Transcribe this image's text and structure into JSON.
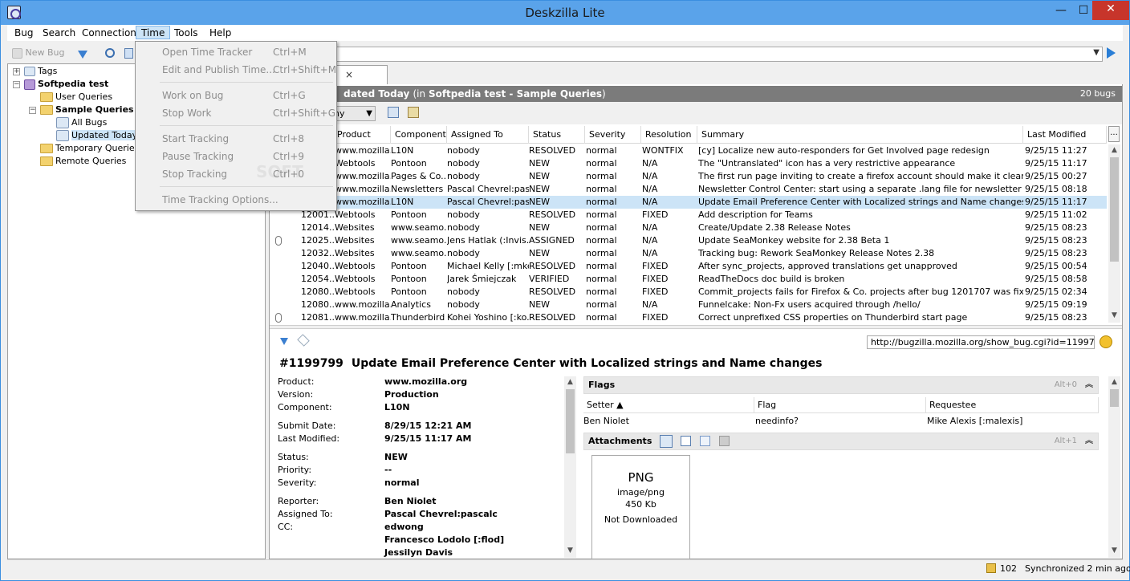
{
  "window": {
    "title": "Deskzilla Lite",
    "minimize": "—",
    "maximize": "☐",
    "close": "✕"
  },
  "menubar": [
    "Bug",
    "Search",
    "Connection",
    "Time",
    "Tools",
    "Help"
  ],
  "toolbar": {
    "new_bug": "New Bug"
  },
  "time_menu": [
    {
      "label": "Open Time Tracker",
      "shortcut": "Ctrl+M"
    },
    {
      "label": "Edit and Publish Time...",
      "shortcut": "Ctrl+Shift+M"
    },
    {
      "label": "Work on Bug",
      "shortcut": "Ctrl+G"
    },
    {
      "label": "Stop Work",
      "shortcut": "Ctrl+Shift+G"
    },
    {
      "label": "Start Tracking",
      "shortcut": "Ctrl+8"
    },
    {
      "label": "Pause Tracking",
      "shortcut": "Ctrl+9"
    },
    {
      "label": "Stop Tracking",
      "shortcut": "Ctrl+0"
    },
    {
      "label": "Time Tracking Options...",
      "shortcut": ""
    }
  ],
  "tree": {
    "tags": "Tags",
    "connection": "Softpedia test",
    "user_queries": "User Queries",
    "sample_queries": "Sample Queries",
    "all_bugs": "All Bugs",
    "updated_today": "Updated Today",
    "temporary_queries": "Temporary Queries",
    "remote_queries": "Remote Queries"
  },
  "query_header": {
    "title_part1": "dated Today",
    "title_part2": "(in ",
    "title_part3": "Softpedia test - Sample Queries",
    "title_part4": ")",
    "count": "20 bugs"
  },
  "hierarchy_combo": "chy",
  "columns": [
    "Product",
    "Component",
    "Assigned To",
    "Status",
    "Severity",
    "Resolution",
    "Summary",
    "Last Modified"
  ],
  "more_columns": "...",
  "bugs": [
    {
      "id": "",
      "product": "www.mozilla...",
      "component": "L10N",
      "assigned": "nobody",
      "status": "RESOLVED",
      "severity": "normal",
      "resolution": "WONTFIX",
      "summary": "[cy] Localize new auto-responders for Get Involved page redesign",
      "modified": "9/25/15 11:27",
      "attach": false
    },
    {
      "id": "",
      "product": "Webtools",
      "component": "Pontoon",
      "assigned": "nobody",
      "status": "NEW",
      "severity": "normal",
      "resolution": "N/A",
      "summary": "The \"Untranslated\" icon has a very restrictive appearance",
      "modified": "9/25/15 11:17",
      "attach": false
    },
    {
      "id": "",
      "product": "www.mozilla...",
      "component": "Pages & Co...",
      "assigned": "nobody",
      "status": "NEW",
      "severity": "normal",
      "resolution": "N/A",
      "summary": "The first run page inviting to create a firefox account should make it clearer that it...",
      "modified": "9/25/15 00:27",
      "attach": false
    },
    {
      "id": "",
      "product": "www.mozilla...",
      "component": "Newsletters",
      "assigned": "Pascal Chevrel:pas...",
      "status": "NEW",
      "severity": "normal",
      "resolution": "N/A",
      "summary": "Newsletter Control Center: start using a separate .lang file for newsletter locales",
      "modified": "9/25/15 08:18",
      "attach": false
    },
    {
      "id": "",
      "product": "www.mozilla...",
      "component": "L10N",
      "assigned": "Pascal Chevrel:pas...",
      "status": "NEW",
      "severity": "normal",
      "resolution": "N/A",
      "summary": "Update Email Preference Center with Localized strings and Name changes",
      "modified": "9/25/15 11:17",
      "attach": false,
      "selected": true
    },
    {
      "id": "12001...",
      "product": "Webtools",
      "component": "Pontoon",
      "assigned": "nobody",
      "status": "RESOLVED",
      "severity": "normal",
      "resolution": "FIXED",
      "summary": "Add description for Teams",
      "modified": "9/25/15 11:02",
      "attach": false
    },
    {
      "id": "12014...",
      "product": "Websites",
      "component": "www.seamo...",
      "assigned": "nobody",
      "status": "NEW",
      "severity": "normal",
      "resolution": "N/A",
      "summary": "Create/Update 2.38 Release Notes",
      "modified": "9/25/15 08:23",
      "attach": false
    },
    {
      "id": "12025...",
      "product": "Websites",
      "component": "www.seamo...",
      "assigned": "Jens Hatlak (:Invis...",
      "status": "ASSIGNED",
      "severity": "normal",
      "resolution": "N/A",
      "summary": "Update SeaMonkey website for 2.38 Beta 1",
      "modified": "9/25/15 08:23",
      "attach": true
    },
    {
      "id": "12032...",
      "product": "Websites",
      "component": "www.seamo...",
      "assigned": "nobody",
      "status": "NEW",
      "severity": "normal",
      "resolution": "N/A",
      "summary": "Tracking bug: Rework SeaMonkey Release Notes 2.38",
      "modified": "9/25/15 08:23",
      "attach": false
    },
    {
      "id": "12040...",
      "product": "Webtools",
      "component": "Pontoon",
      "assigned": "Michael Kelly [:mke...",
      "status": "RESOLVED",
      "severity": "normal",
      "resolution": "FIXED",
      "summary": "After sync_projects, approved translations get unapproved",
      "modified": "9/25/15 00:54",
      "attach": false
    },
    {
      "id": "12054...",
      "product": "Webtools",
      "component": "Pontoon",
      "assigned": "Jarek Śmiejczak",
      "status": "VERIFIED",
      "severity": "normal",
      "resolution": "FIXED",
      "summary": "ReadTheDocs doc build is broken",
      "modified": "9/25/15 08:58",
      "attach": false
    },
    {
      "id": "12080...",
      "product": "Webtools",
      "component": "Pontoon",
      "assigned": "nobody",
      "status": "RESOLVED",
      "severity": "normal",
      "resolution": "FIXED",
      "summary": "Commit_projects fails for Firefox & Co. projects after bug 1201707 was fixed",
      "modified": "9/25/15 02:34",
      "attach": false
    },
    {
      "id": "12080...",
      "product": "www.mozilla...",
      "component": "Analytics",
      "assigned": "nobody",
      "status": "NEW",
      "severity": "normal",
      "resolution": "N/A",
      "summary": "Funnelcake: Non-Fx users acquired through /hello/",
      "modified": "9/25/15 09:19",
      "attach": false
    },
    {
      "id": "12081...",
      "product": "www.mozilla...",
      "component": "Thunderbird",
      "assigned": "Kohei Yoshino [:ko...",
      "status": "RESOLVED",
      "severity": "normal",
      "resolution": "FIXED",
      "summary": "Correct unprefixed CSS properties on Thunderbird start page",
      "modified": "9/25/15 08:23",
      "attach": true
    }
  ],
  "detail": {
    "url": "http://bugzilla.mozilla.org/show_bug.cgi?id=1199799",
    "bug_number": "#1199799",
    "bug_title": "Update Email Preference Center with Localized strings and Name changes",
    "fields": [
      {
        "label": "Product:",
        "value": "www.mozilla.org"
      },
      {
        "label": "Version:",
        "value": "Production"
      },
      {
        "label": "Component:",
        "value": "L10N"
      },
      {
        "label": "Submit Date:",
        "value": "8/29/15 12:21 AM"
      },
      {
        "label": "Last Modified:",
        "value": "9/25/15 11:17 AM"
      },
      {
        "label": "Status:",
        "value": "NEW"
      },
      {
        "label": "Priority:",
        "value": "--"
      },
      {
        "label": "Severity:",
        "value": "normal"
      },
      {
        "label": "Reporter:",
        "value": "Ben Niolet"
      },
      {
        "label": "Assigned To:",
        "value": "Pascal Chevrel:pascalc"
      },
      {
        "label": "CC:",
        "value": "edwong"
      }
    ],
    "cc_more": [
      "Francesco Lodolo [:flod]",
      "Jessilyn Davis"
    ],
    "flags": {
      "title": "Flags",
      "shortcut": "Alt+0",
      "headers": [
        "Setter ▲",
        "Flag",
        "Requestee"
      ],
      "row": [
        "Ben Niolet",
        "needinfo?",
        "Mike Alexis [:malexis]"
      ]
    },
    "attachments": {
      "title": "Attachments",
      "shortcut": "Alt+1",
      "type": "PNG",
      "mime": "image/png",
      "size": "450 Kb",
      "state": "Not Downloaded"
    }
  },
  "statusbar": {
    "count": "102",
    "sync": "Synchronized 2 min ago"
  },
  "watermark": "SOFT"
}
